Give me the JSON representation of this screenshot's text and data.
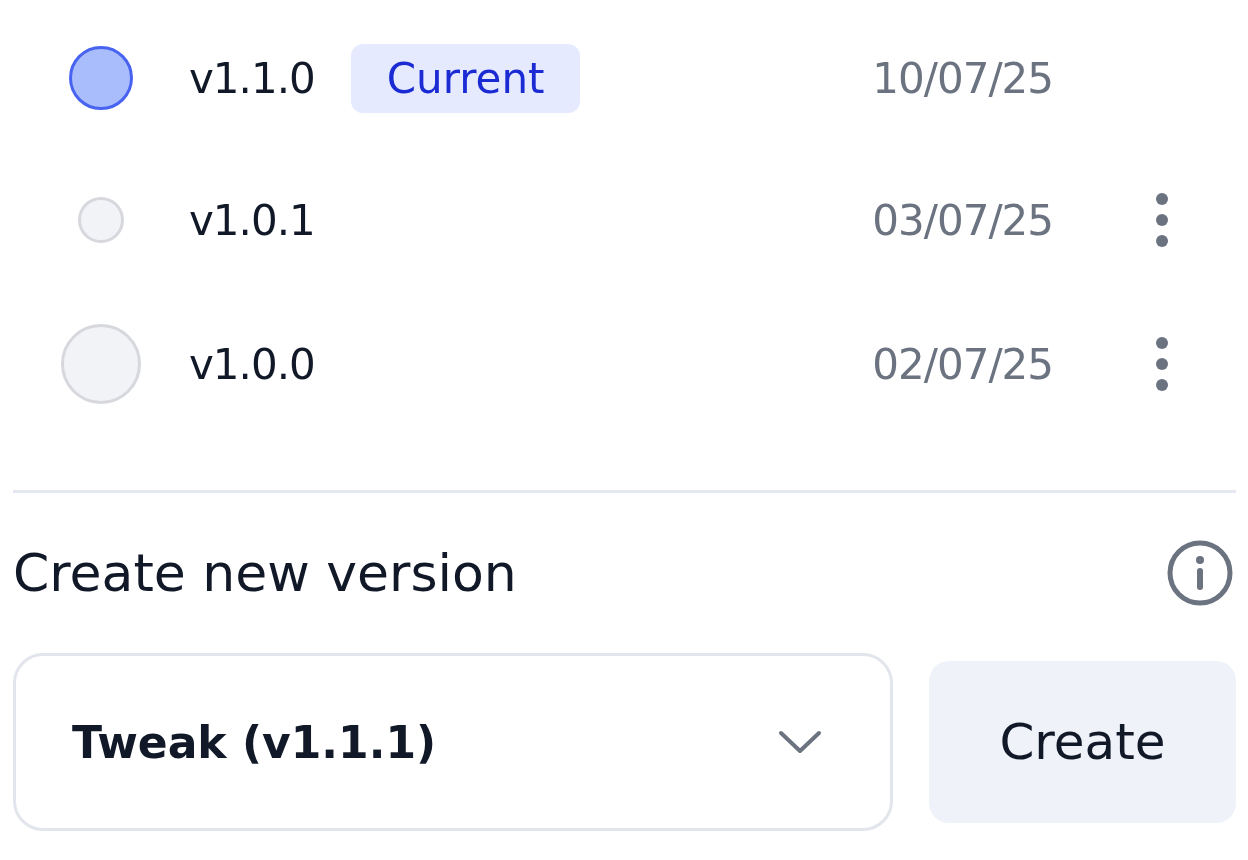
{
  "versions": [
    {
      "version": "v1.1.0",
      "badge": "Current",
      "date": "10/07/25",
      "kind": "major",
      "selected": true,
      "has_menu": false
    },
    {
      "version": "v1.0.1",
      "date": "03/07/25",
      "kind": "minor",
      "selected": false,
      "has_menu": true
    },
    {
      "version": "v1.0.0",
      "date": "02/07/25",
      "kind": "major",
      "selected": false,
      "has_menu": true
    }
  ],
  "create": {
    "title": "Create new version",
    "select_value": "Tweak (v1.1.1)",
    "button": "Create"
  }
}
